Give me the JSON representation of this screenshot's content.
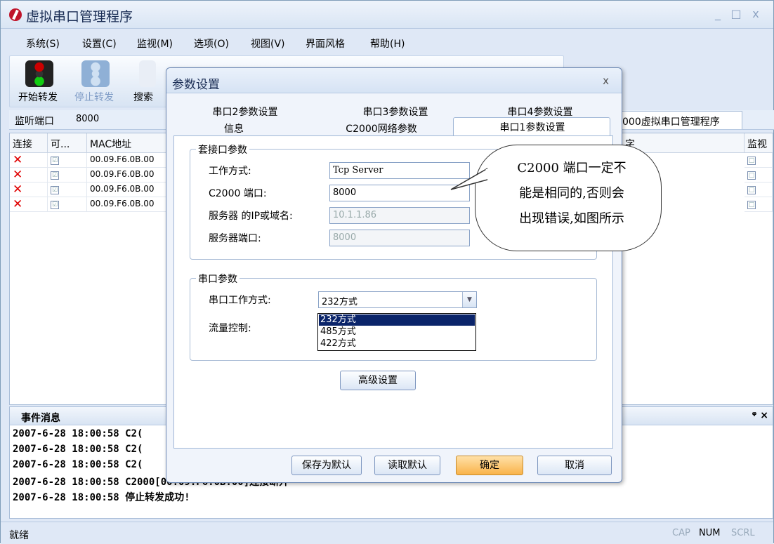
{
  "window": {
    "title": "虚拟串口管理程序",
    "minimize": "_",
    "maximize": "□",
    "close": "x"
  },
  "menu": [
    "系统(S)",
    "设置(C)",
    "监视(M)",
    "选项(O)",
    "视图(V)",
    "界面风格",
    "帮助(H)"
  ],
  "toolbar": {
    "start": "开始转发",
    "stop": "停止转发",
    "search": "搜索"
  },
  "listen": {
    "label": "监听端口",
    "value": "8000"
  },
  "right_tab": "000虚拟串口管理程序",
  "grid": {
    "headers": [
      "连接",
      "可...",
      "MAC地址",
      "字",
      "监视"
    ],
    "rows": [
      {
        "conn": "✕",
        "check": "☑",
        "mac": "00.09.F6.0B.00",
        "monitor": "□"
      },
      {
        "conn": "✕",
        "check": "☑",
        "mac": "00.09.F6.0B.00",
        "monitor": "□"
      },
      {
        "conn": "✕",
        "check": "☑",
        "mac": "00.09.F6.0B.00",
        "monitor": "□"
      },
      {
        "conn": "✕",
        "check": "☑",
        "mac": "00.09.F6.0B.00",
        "monitor": "□"
      }
    ]
  },
  "events": {
    "title": "事件消息",
    "controls": "ᵠ ×",
    "lines": [
      "2007-6-28 18:00:58  C2(",
      "2007-6-28 18:00:58  C2(",
      "2007-6-28 18:00:58  C2(",
      "2007-6-28 18:00:58  C2000[00.09.F6.0B.00]连接断开",
      "2007-6-28 18:00:58  停止转发成功!"
    ]
  },
  "status": {
    "text": "就绪",
    "cap": "CAP",
    "num": "NUM",
    "scrl": "SCRL"
  },
  "dialog": {
    "title": "参数设置",
    "close": "x",
    "tabs_row1": [
      "串口2参数设置",
      "串口3参数设置",
      "串口4参数设置"
    ],
    "tabs_row2": [
      "信息",
      "C2000网络参数",
      "串口1参数设置"
    ],
    "socket_group": "套接口参数",
    "work_mode_label": "工作方式:",
    "work_mode_value": "Tcp Server",
    "c2000_port_label": "C2000 端口:",
    "c2000_port_value": "8000",
    "server_ip_label": "服务器 的IP或域名:",
    "server_ip_value": "10.1.1.86",
    "server_port_label": "服务器端口:",
    "server_port_value": "8000",
    "serial_group": "串口参数",
    "serial_mode_label": "串口工作方式:",
    "serial_mode_value": "232方式",
    "serial_options": [
      "232方式",
      "485方式",
      "422方式"
    ],
    "flow_label": "流量控制:",
    "advanced": "高级设置",
    "save_default": "保存为默认",
    "read_default": "读取默认",
    "ok": "确定",
    "cancel": "取消"
  },
  "callout": {
    "lines": [
      "C2000 端口一定不",
      "能是相同的,否则会",
      "出现错误,如图所示"
    ]
  }
}
